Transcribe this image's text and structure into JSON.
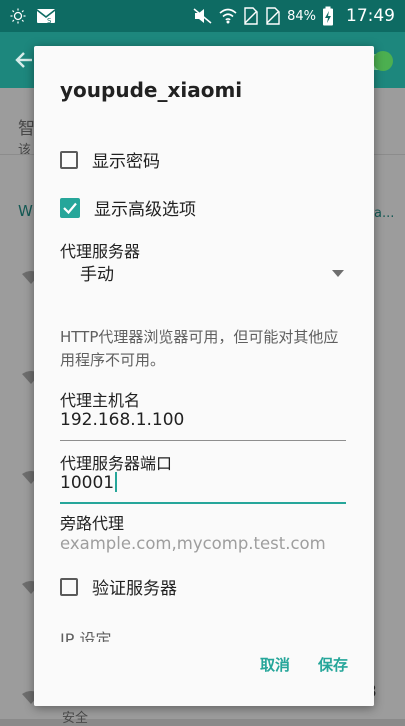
{
  "status_bar": {
    "battery_percent": "84%",
    "time": "17:49",
    "icons": [
      "brightness-icon",
      "gmail-notification-icon",
      "mute-icon",
      "wifi-icon",
      "no-sim-icon",
      "no-sim-icon",
      "battery-charging-icon"
    ]
  },
  "background": {
    "setting_title_partial": "智",
    "setting_subtitle_partial": "该",
    "section_header_partial": "W",
    "section_header_trailing": "a...",
    "bottom_number": "3",
    "bottom_text_partial": "安全"
  },
  "dialog": {
    "title": "youpude_xiaomi",
    "show_password_label": "显示密码",
    "show_password_checked": false,
    "advanced_options_label": "显示高级选项",
    "advanced_options_checked": true,
    "proxy_label": "代理服务器",
    "proxy_value": "手动",
    "proxy_note": "HTTP代理器浏览器可用，但可能对其他应用程序不可用。",
    "hostname_label": "代理主机名",
    "hostname_value": "192.168.1.100",
    "port_label": "代理服务器端口",
    "port_value": "10001",
    "bypass_label": "旁路代理",
    "bypass_placeholder": "example.com,mycomp.test.com",
    "verify_server_label": "验证服务器",
    "verify_server_checked": false,
    "ip_settings_label_partial": "IP 设定",
    "cancel_label": "取消",
    "save_label": "保存"
  },
  "colors": {
    "accent": "#26a69a",
    "status_bar": "#0e6b63"
  }
}
